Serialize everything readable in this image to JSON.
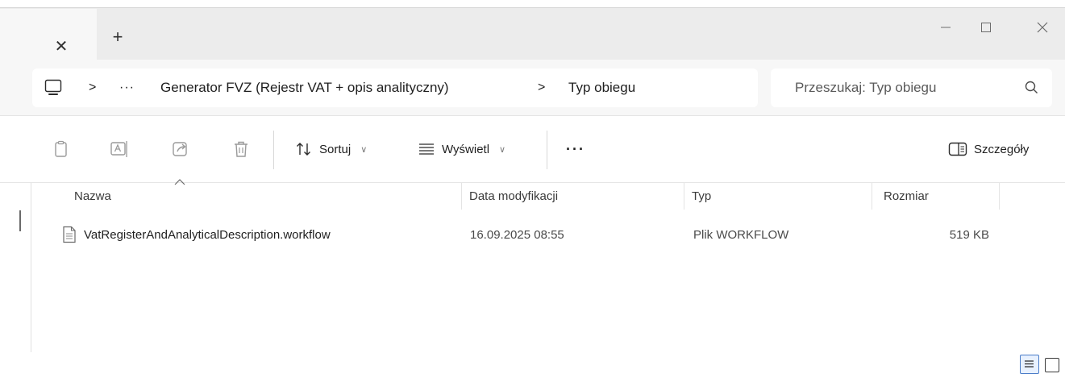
{
  "window": {
    "tab_close_glyph": "✕",
    "new_tab_glyph": "+"
  },
  "address": {
    "overflow": "···",
    "breadcrumb": [
      "Generator FVZ (Rejestr VAT + opis analityczny)",
      "Typ obiegu"
    ],
    "separator": ">"
  },
  "search": {
    "placeholder": "Przeszukaj: Typ obiegu"
  },
  "toolbar": {
    "sort_label": "Sortuj",
    "view_label": "Wyświetl",
    "more_label": "···",
    "details_label": "Szczegóły"
  },
  "columns": {
    "name": "Nazwa",
    "date": "Data modyfikacji",
    "type": "Typ",
    "size": "Rozmiar"
  },
  "files": [
    {
      "name": "VatRegisterAndAnalyticalDescription.workflow",
      "date": "16.09.2025 08:55",
      "type": "Plik WORKFLOW",
      "size": "519 KB"
    }
  ],
  "icons": {
    "computer": "computer-icon",
    "search": "search-icon",
    "copy": "copy-icon",
    "rename": "rename-icon",
    "share": "share-icon",
    "delete": "delete-icon",
    "sort": "sort-icon",
    "view": "view-icon",
    "details": "details-pane-icon",
    "file": "file-icon"
  },
  "colors": {
    "accent": "#4a7cc8",
    "titlebar": "#ececec",
    "tab": "#f7f7f7"
  }
}
